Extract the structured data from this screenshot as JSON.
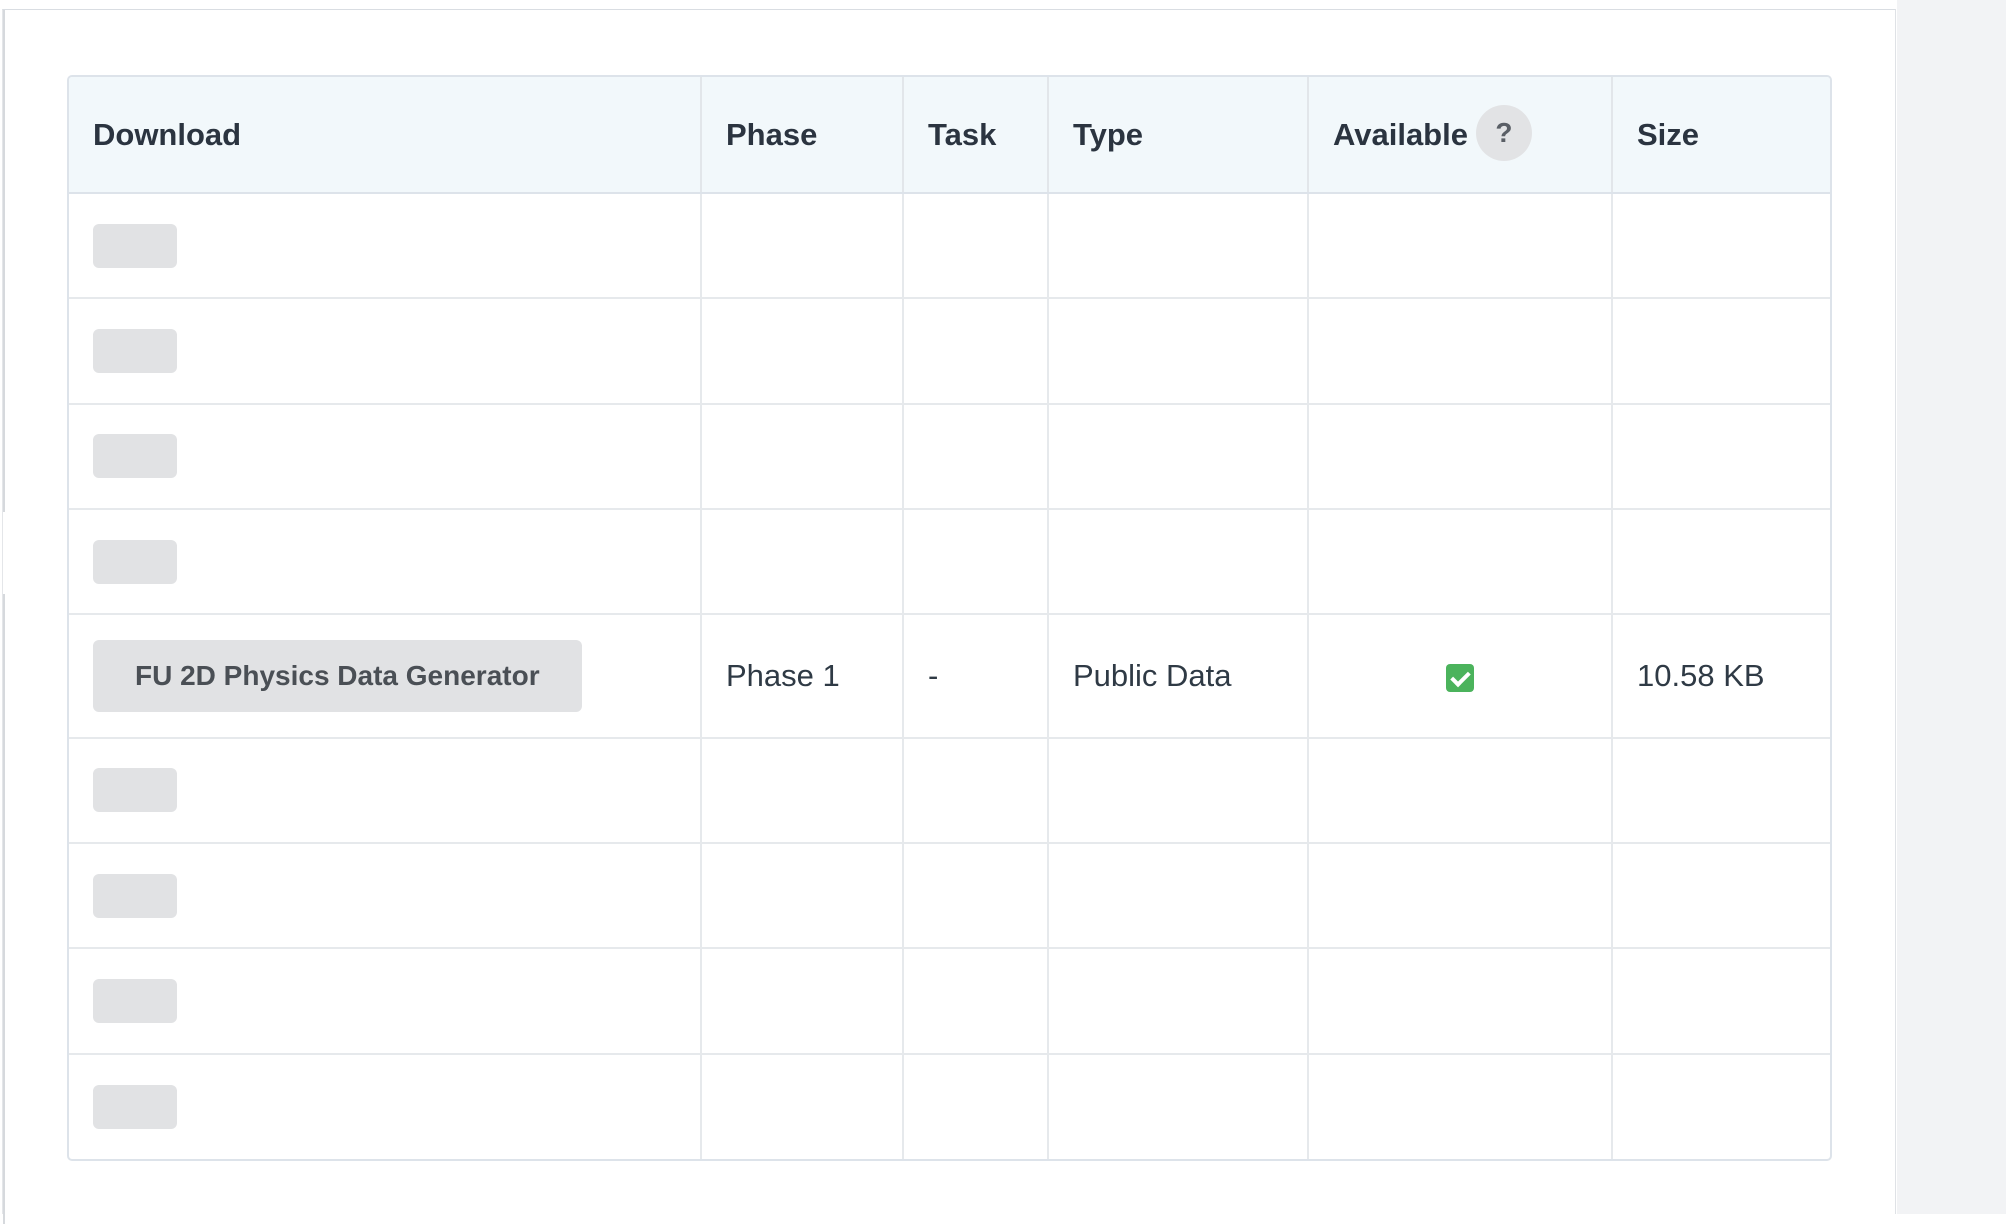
{
  "table": {
    "headers": {
      "download": "Download",
      "phase": "Phase",
      "task": "Task",
      "type": "Type",
      "available": "Available",
      "size": "Size"
    },
    "help_icon_glyph": "?",
    "rows": [
      {
        "download": "",
        "placeholder": true
      },
      {
        "download": "",
        "placeholder": true
      },
      {
        "download": "",
        "placeholder": true
      },
      {
        "download": "",
        "placeholder": true
      },
      {
        "download": "FU 2D Physics Data Generator",
        "phase": "Phase 1",
        "task": "-",
        "type": "Public Data",
        "available": true,
        "size": "10.58 KB"
      },
      {
        "download": "",
        "placeholder": true
      },
      {
        "download": "",
        "placeholder": true
      },
      {
        "download": "",
        "placeholder": true
      },
      {
        "download": "",
        "placeholder": true
      }
    ]
  },
  "colors": {
    "header_bg": "#f2f8fb",
    "check_green": "#4bb35c",
    "button_gray": "#e1e2e4"
  },
  "icons": {
    "help": "question-circle-icon",
    "available": "checkbox-checked-icon"
  }
}
